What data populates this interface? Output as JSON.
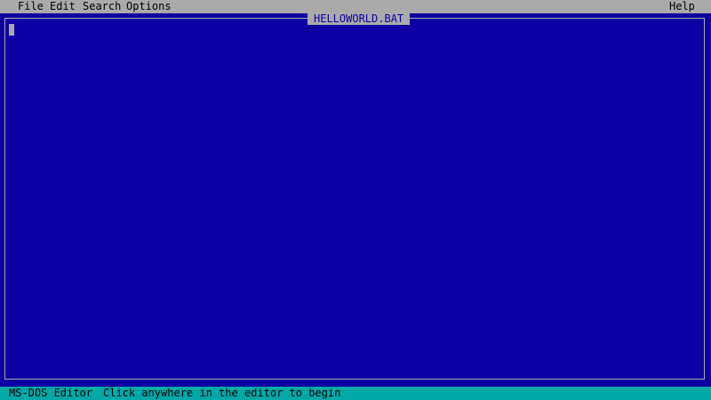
{
  "menu": {
    "file": "File",
    "edit": "Edit",
    "search": "Search",
    "options": "Options",
    "help": "Help"
  },
  "editor": {
    "file_name": "HELLOWORLD.BAT",
    "content": ""
  },
  "status": {
    "app_name": "MS-DOS Editor",
    "message": "Click anywhere in the editor to begin"
  },
  "colors": {
    "editor_background": "#0c00a3",
    "menu_background": "#aaaaaa",
    "status_background": "#00a8a8",
    "cursor": "#aaaaaa"
  }
}
